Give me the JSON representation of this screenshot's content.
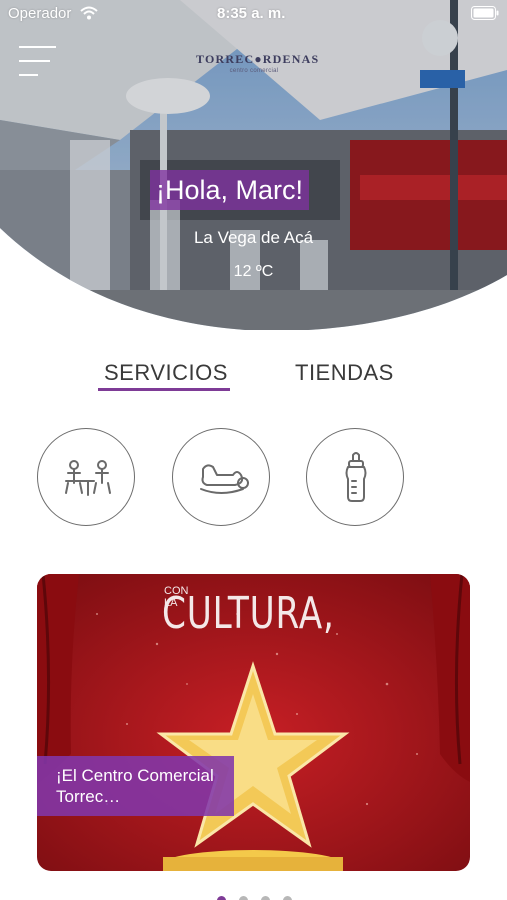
{
  "status_bar": {
    "carrier": "Operador",
    "time": "8:35 a. m."
  },
  "header": {
    "menu_icon": "hamburger-menu-icon",
    "logo": {
      "name": "TORREC●RDENAS",
      "tagline": "centro comercial"
    }
  },
  "hero": {
    "greeting": "¡Hola, Marc!",
    "location": "La Vega de Acá",
    "temperature": "12 ºC"
  },
  "tabs": [
    {
      "label": "SERVICIOS",
      "active": true
    },
    {
      "label": "TIENDAS",
      "active": false
    }
  ],
  "services": [
    {
      "icon": "family-play-area-icon"
    },
    {
      "icon": "rocking-horse-icon"
    },
    {
      "icon": "baby-bottle-icon"
    }
  ],
  "banner": {
    "small_text": "CON\nLA",
    "headline": "CULTURA,",
    "caption": "¡El Centro Comercial Torrec…"
  },
  "pager": {
    "count": 4,
    "active_index": 0
  },
  "colors": {
    "accent": "#7e3b96",
    "banner_red": "#a8151b",
    "text": "#3a3a3a",
    "star": "#f7d35a"
  }
}
